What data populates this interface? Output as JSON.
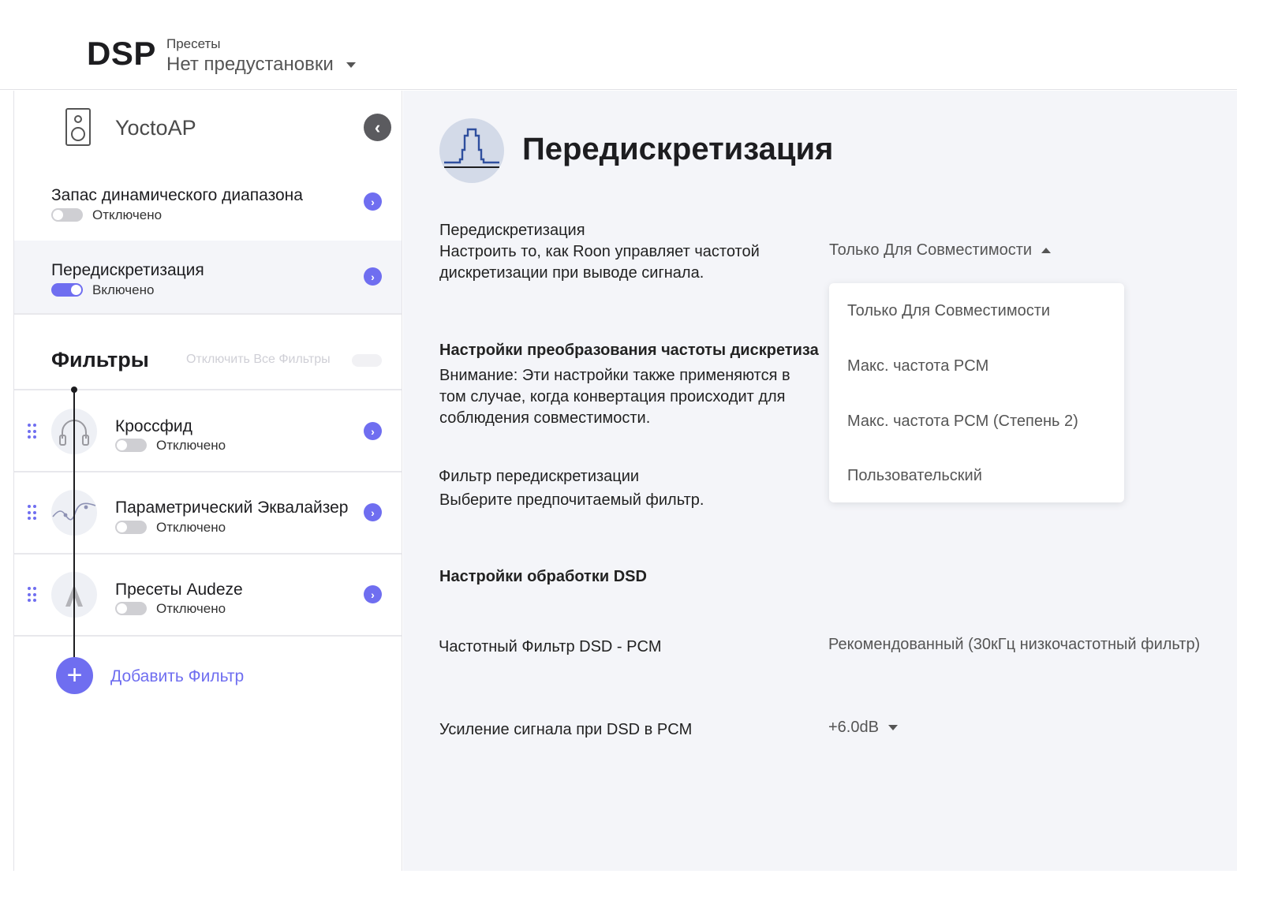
{
  "header": {
    "title": "DSP",
    "preset_label": "Пресеты",
    "preset_value": "Нет предустановки"
  },
  "sidebar": {
    "device_name": "YoctoAP",
    "items": [
      {
        "title": "Запас динамического диапазона",
        "status": "Отключено",
        "enabled": false
      },
      {
        "title": "Передискретизация",
        "status": "Включено",
        "enabled": true
      }
    ],
    "filters_title": "Фильтры",
    "disable_all_label": "Отключить Все Фильтры",
    "filters": [
      {
        "title": "Кроссфид",
        "status": "Отключено",
        "icon": "headphones-icon",
        "enabled": false
      },
      {
        "title": "Параметрический Эквалайзер",
        "status": "Отключено",
        "icon": "eq-curve-icon",
        "enabled": false
      },
      {
        "title": "Пресеты Audeze",
        "status": "Отключено",
        "icon": "audeze-logo-icon",
        "enabled": false
      }
    ],
    "add_filter_label": "Добавить Фильтр"
  },
  "main": {
    "title": "Передискретизация",
    "resampling": {
      "label": "Передискретизация",
      "description_line1": "Настроить то, как Roon управляет частотой",
      "description_line2": "дискретизации при выводе сигнала.",
      "value": "Только Для Совместимости",
      "options": [
        "Только Для Совместимости",
        "Макс. частота PCM",
        "Макс. частота PCM (Степень 2)",
        "Пользовательский"
      ]
    },
    "conversion_settings": {
      "heading": "Настройки преобразования частоты дискретиза",
      "line1": "Внимание: Эти настройки также применяются в",
      "line2": "том случае, когда конвертация происходит для",
      "line3": "соблюдения совместимости."
    },
    "filter": {
      "label": "Фильтр передискретизации",
      "description": "Выберите предпочитаемый фильтр."
    },
    "dsd_heading": "Настройки обработки DSD",
    "dsd_filter": {
      "label": "Частотный Фильтр DSD - PCM",
      "value": "Рекомендованный (30кГц низкочастотный фильтр)"
    },
    "dsd_gain": {
      "label": "Усиление сигнала при DSD в PCM",
      "value": "+6.0dB"
    }
  },
  "colors": {
    "accent": "#6f6ef0",
    "main_bg": "#f4f5f9"
  }
}
